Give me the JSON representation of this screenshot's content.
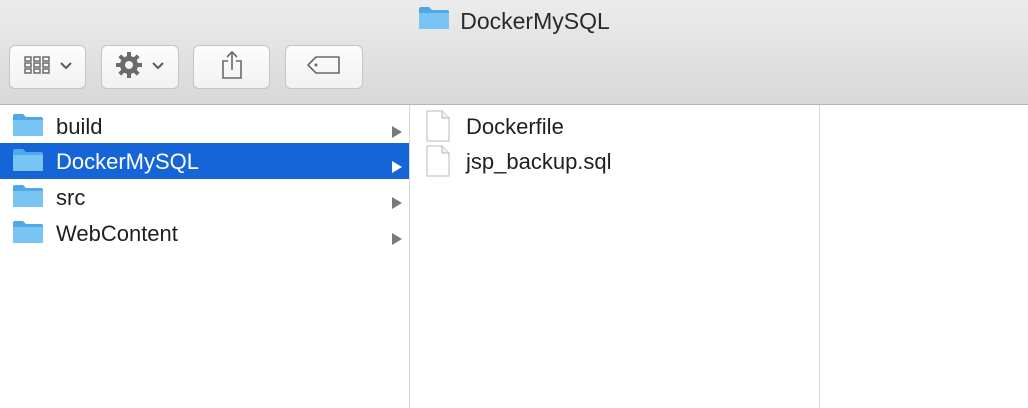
{
  "window": {
    "title": "DockerMySQL"
  },
  "toolbar": {
    "view_icon": "grid-view-icon",
    "action_icon": "gear-icon",
    "share_icon": "share-icon",
    "tag_icon": "tag-icon"
  },
  "column1": {
    "items": [
      {
        "label": "build",
        "icon": "folder-icon",
        "selected": false
      },
      {
        "label": "DockerMySQL",
        "icon": "folder-icon",
        "selected": true
      },
      {
        "label": "src",
        "icon": "folder-icon",
        "selected": false
      },
      {
        "label": "WebContent",
        "icon": "folder-icon",
        "selected": false
      }
    ]
  },
  "column2": {
    "items": [
      {
        "label": "Dockerfile",
        "icon": "document-icon"
      },
      {
        "label": "jsp_backup.sql",
        "icon": "document-icon"
      }
    ]
  },
  "colors": {
    "selection": "#1564d8",
    "folder": "#5fb8f0"
  }
}
